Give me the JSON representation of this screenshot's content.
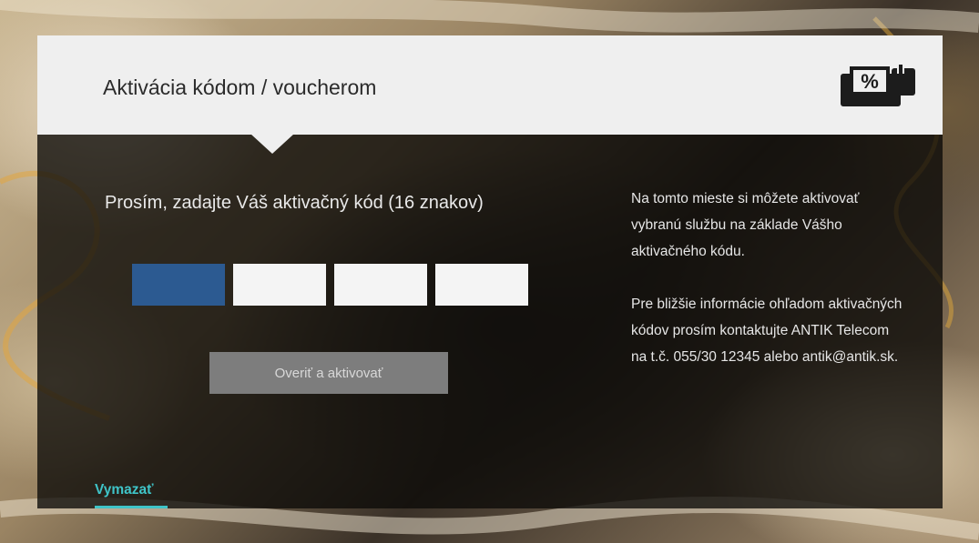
{
  "dialog": {
    "title": "Aktivácia kódom / voucherom",
    "icon": "voucher-percent-icon",
    "prompt": "Prosím, zadajte Váš aktivačný kód (16 znakov)",
    "code_fields": [
      {
        "value": "",
        "state": "focused"
      },
      {
        "value": "",
        "state": "empty"
      },
      {
        "value": "",
        "state": "empty"
      },
      {
        "value": "",
        "state": "empty"
      }
    ],
    "verify_button_label": "Overiť a aktivovať",
    "info_paragraphs": [
      "Na tomto mieste si môžete aktivovať vybranú službu na základe Vášho aktivačného kódu.",
      "Pre bližšie informácie ohľadom aktivačných kódov prosím kontaktujte ANTIK Telecom na t.č. 055/30 12345 alebo antik@antik.sk."
    ],
    "clear_label": "Vymazať"
  },
  "colors": {
    "header_bg": "#efefef",
    "body_overlay": "#0c0a08",
    "active_field": "#2c5a91",
    "accent": "#3fc4c8",
    "button_bg": "#7d7d7d"
  }
}
